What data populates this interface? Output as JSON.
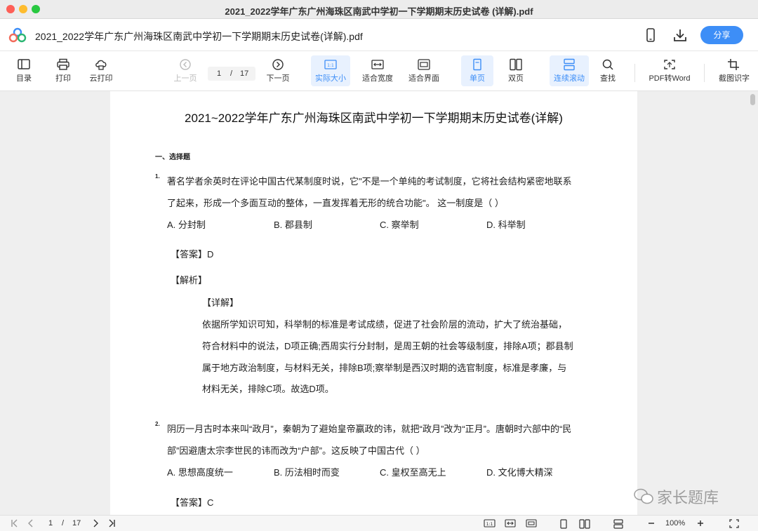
{
  "window": {
    "title": "2021_2022学年广东广州海珠区南武中学初一下学期期末历史试卷 (详解).pdf"
  },
  "docbar": {
    "filename": "2021_2022学年广东广州海珠区南武中学初一下学期期末历史试卷(详解).pdf",
    "share_label": "分享"
  },
  "toolbar": {
    "toc": "目录",
    "print": "打印",
    "cloud_print": "云打印",
    "prev_page": "上一页",
    "next_page": "下一页",
    "current_page": "1",
    "page_sep": "/",
    "total_pages": "17",
    "actual_size": "实际大小",
    "fit_width": "适合宽度",
    "fit_page": "适合界面",
    "single_page": "单页",
    "double_page": "双页",
    "continuous": "连续滚动",
    "find": "查找",
    "pdf_to_word": "PDF转Word",
    "ocr": "截图识字",
    "actual_size_icon_text": "1:1"
  },
  "document": {
    "title": "2021~2022学年广东广州海珠区南武中学初一下学期期末历史试卷(详解)",
    "section": "一、选择题",
    "q1": {
      "num": "1.",
      "line1": "著名学者余英时在评论中国古代某制度时说，它\"不是一个单纯的考试制度，它将社会结构紧密地联系",
      "line2": "了起来，形成一个多面互动的整体，一直发挥着无形的统合功能\"。 这一制度是（      ）",
      "options": [
        "A. 分封制",
        "B. 郡县制",
        "C. 察举制",
        "D. 科举制"
      ],
      "answer_label": "【答案】D",
      "analysis_label": "【解析】",
      "detail_label": "【详解】",
      "detail_lines": [
        "依据所学知识可知，科举制的标准是考试成绩，促进了社会阶层的流动，扩大了统治基础，",
        "符合材料中的说法，D项正确;西周实行分封制，是周王朝的社会等级制度，排除A项；郡县制",
        "属于地方政治制度，与材料无关，排除B项;察举制是西汉时期的选官制度，标准是孝廉，与",
        "材料无关，排除C项。故选D项。"
      ]
    },
    "q2": {
      "num": "2.",
      "line1": "阴历一月古时本来叫“政月”，秦朝为了避始皇帝嬴政的讳，就把“政月”改为“正月”。唐朝时六部中的“民",
      "line2": "部”因避唐太宗李世民的讳而改为“户部”。这反映了中国古代（      ）",
      "options": [
        "A. 思想高度统一",
        "B. 历法相时而变",
        "C. 皇权至高无上",
        "D. 文化博大精深"
      ],
      "answer_label": "【答案】C"
    }
  },
  "watermark": {
    "text": "家长题库"
  },
  "statusbar": {
    "current_page": "1",
    "page_sep": "/",
    "total_pages": "17",
    "zoom": "100%",
    "actual_size_icon_text": "1:1"
  },
  "colors": {
    "accent": "#3d8ef7",
    "active_bg": "#e8f1fe"
  }
}
